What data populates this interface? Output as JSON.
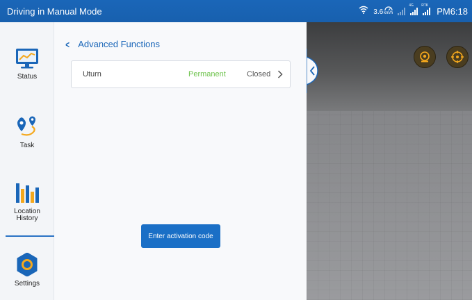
{
  "statusbar": {
    "title": "Driving in Manual Mode",
    "speed_value": "3.6",
    "speed_unit": "km/h",
    "signal1_tag": "4G",
    "signal2_tag": "RTK",
    "time": "PM6:18",
    "icons": [
      "wifi-icon",
      "speed-gauge-icon",
      "signal-icon",
      "4g-signal-icon",
      "rtk-signal-icon"
    ]
  },
  "sidebar": {
    "items": [
      {
        "label": "Status",
        "icon": "monitor-chart-icon"
      },
      {
        "label": "Task",
        "icon": "route-pin-icon"
      },
      {
        "label": "Location\nHistory",
        "icon": "bar-chart-icon"
      },
      {
        "label": "Settings",
        "icon": "gear-icon"
      }
    ],
    "selected": "Settings"
  },
  "main": {
    "back_icon": "chevron-left-icon",
    "title": "Advanced Functions",
    "rows": [
      {
        "name": "Uturn",
        "license": "Permanent",
        "state": "Closed"
      }
    ],
    "activate_label": "Enter activation code"
  },
  "view": {
    "buttons": [
      "camera-icon",
      "target-icon"
    ]
  },
  "colors": {
    "brand": "#1a66b8",
    "permanent": "#6cc24a",
    "accent_orange": "#f4a81d"
  }
}
